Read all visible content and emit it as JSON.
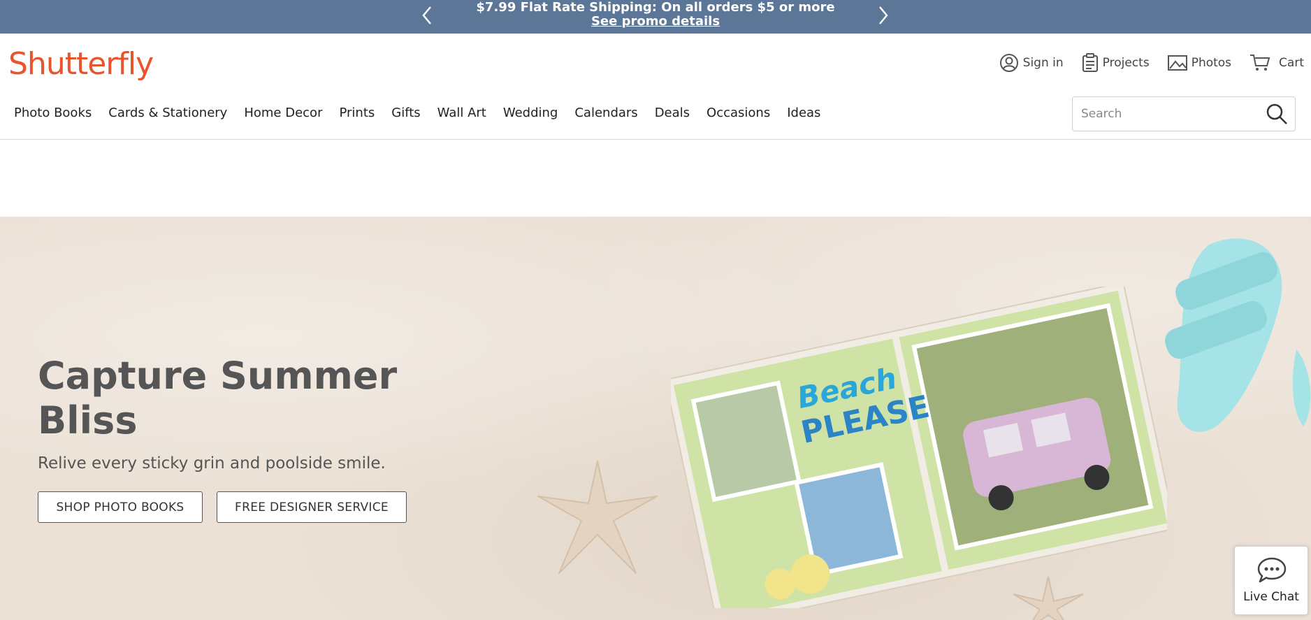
{
  "promo": {
    "headline": "$7.99 Flat Rate Shipping: On all orders $5 or more",
    "link": "See promo details",
    "prev_icon": "chevron-left-icon",
    "next_icon": "chevron-right-icon"
  },
  "brand": {
    "logo": "Shutterfly",
    "color": "#e8542c"
  },
  "utility_nav": [
    {
      "label": "Sign in",
      "icon": "user-icon"
    },
    {
      "label": "Projects",
      "icon": "clipboard-icon"
    },
    {
      "label": "Photos",
      "icon": "image-icon"
    },
    {
      "label": "Cart",
      "icon": "cart-icon"
    }
  ],
  "main_nav": [
    "Photo Books",
    "Cards & Stationery",
    "Home Decor",
    "Prints",
    "Gifts",
    "Wall Art",
    "Wedding",
    "Calendars",
    "Deals",
    "Occasions",
    "Ideas"
  ],
  "search": {
    "placeholder": "Search",
    "value": ""
  },
  "hero": {
    "headline": "Capture Summer Bliss",
    "subhead": "Relive every sticky grin and poolside smile.",
    "primary_button": "SHOP PHOTO BOOKS",
    "secondary_button": "FREE DESIGNER SERVICE",
    "book_text_1": "Beach",
    "book_text_2": "PLEASE"
  },
  "live_chat": {
    "label": "Live Chat",
    "icon": "chat-bubble-icon"
  },
  "colors": {
    "promo_bar": "#5b7696",
    "hero_bg": "#ebe1d6",
    "brand": "#e8542c"
  }
}
